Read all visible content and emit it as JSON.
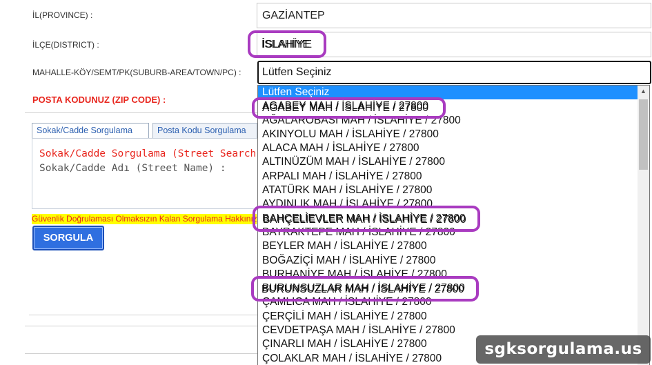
{
  "form": {
    "province_label": "İL(PROVINCE) :",
    "province_value": "GAZİANTEP",
    "district_label": "İLÇE(DISTRICT) :",
    "district_value": "İSLAHİYE",
    "neighborhood_label": "MAHALLE-KÖY/SEMT/PK(SUBURB-AREA/TOWN/PC) :",
    "neighborhood_selected": "Lütfen Seçiniz",
    "zip_label": "POSTA KODUNUZ (ZIP CODE) :"
  },
  "tabs": [
    {
      "label": "Sokak/Cadde Sorgulama"
    },
    {
      "label": "Posta Kodu Sorgulama"
    }
  ],
  "panel": {
    "title": "Sokak/Cadde Sorgulama (Street Search)",
    "subtitle": "Sokak/Cadde Adı (Street Name) :"
  },
  "warning": "Güvenlik Doğrulaması Olmaksızın Kalan Sorgulama Hakkınız",
  "search_button": "SORGULA",
  "dropdown_options": [
    "Lütfen Seçiniz",
    "AGABEY MAH / İSLAHİYE / 27800",
    "AĞALAROBASI MAH / İSLAHİYE / 27800",
    "AKINYOLU MAH / İSLAHİYE / 27800",
    "ALACA MAH / İSLAHİYE / 27800",
    "ALTINÜZÜM MAH / İSLAHİYE / 27800",
    "ARPALI MAH / İSLAHİYE / 27800",
    "ATATÜRK MAH / İSLAHİYE / 27800",
    "AYDINLIK MAH / İSLAHİYE / 27800",
    "BAHÇELİEVLER MAH / İSLAHİYE / 27800",
    "BAYRAKTEPE MAH / İSLAHİYE / 27800",
    "BEYLER MAH / İSLAHİYE / 27800",
    "BOĞAZİÇİ MAH / İSLAHİYE / 27800",
    "BURHANİYE MAH / İSLAHİYE / 27800",
    "BURUNSUZLAR MAH / İSLAHİYE / 27800",
    "ÇAMLICA MAH / İSLAHİYE / 27800",
    "ÇERÇİLİ MAH / İSLAHİYE / 27800",
    "CEVDETPAŞA MAH / İSLAHİYE / 27800",
    "ÇINARLI MAH / İSLAHİYE / 27800",
    "ÇOLAKLAR MAH / İSLAHİYE / 27800"
  ],
  "selected_option": "Lütfen Seçiniz",
  "highlights": {
    "district": "İSLAHİYE",
    "opt1": "AGABEY MAH / İSLAHİYE / 27800",
    "opt2": "BAHÇELİEVLER MAH / İSLAHİYE / 27800",
    "opt3": "BURUNSUZLAR MAH / İSLAHİYE / 27800"
  },
  "watermark": "sgksorgulama.us",
  "colors": {
    "highlight_ring": "#a93bc0",
    "selected_option_bg": "#1e90ff",
    "zip_label": "#e8261e",
    "button": "#2f6fe0"
  },
  "icons": {
    "scroll_up": "scroll-up-arrow-icon"
  }
}
